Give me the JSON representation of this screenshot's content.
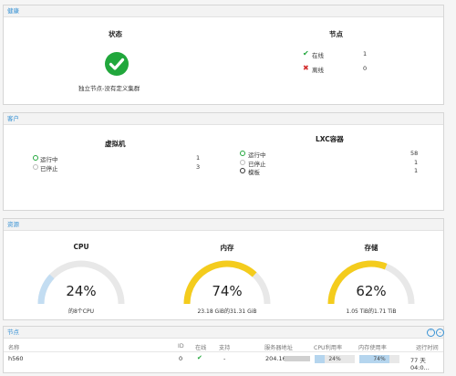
{
  "health": {
    "header": "健康",
    "status_title": "状态",
    "status_desc": "独立节点-没有定义集群",
    "nodes_title": "节点",
    "online_label": "在线",
    "online_count": "1",
    "offline_label": "离线",
    "offline_count": "0"
  },
  "guests": {
    "header": "客户",
    "vm_title": "虚拟机",
    "vm_running_label": "运行中",
    "vm_running_count": "1",
    "vm_stopped_label": "已停止",
    "vm_stopped_count": "3",
    "lxc_title": "LXC容器",
    "lxc_running_label": "运行中",
    "lxc_running_count": "58",
    "lxc_stopped_label": "已停止",
    "lxc_stopped_count": "1",
    "lxc_template_label": "模板",
    "lxc_template_count": "1"
  },
  "resources": {
    "header": "资源",
    "cpu": {
      "title": "CPU",
      "value": "24%",
      "fraction": 0.24,
      "detail": "的8个CPU",
      "color": "#c3ddf2"
    },
    "memory": {
      "title": "内存",
      "value": "74%",
      "fraction": 0.74,
      "detail": "23.18 GiB的31.31 GiB",
      "color": "#f4cc1d"
    },
    "storage": {
      "title": "存储",
      "value": "62%",
      "fraction": 0.62,
      "detail": "1.05 TiB的1.71 TiB",
      "color": "#f4cc1d"
    }
  },
  "nodes": {
    "header": "节点",
    "columns": [
      "名称",
      "ID",
      "在线",
      "支持",
      "服务器地址",
      "CPU利用率",
      "内存使用率",
      "运行时间"
    ],
    "row": {
      "name": "h560",
      "id": "0",
      "support": "-",
      "address": "204.16",
      "cpu": "24%",
      "cpu_fraction": 0.24,
      "mem": "74%",
      "mem_fraction": 0.74,
      "uptime": "77 天 04:0..."
    }
  },
  "colors": {
    "accent": "#3892d4",
    "success": "#21a73c",
    "danger": "#d32f2f",
    "gauge_track": "#e8e8e8"
  }
}
